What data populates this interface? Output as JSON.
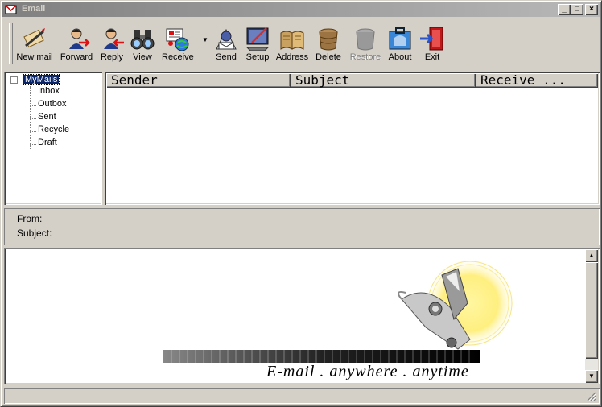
{
  "window": {
    "title": "Email"
  },
  "toolbar": {
    "buttons": [
      {
        "label": "New mail",
        "icon": "new-mail-icon",
        "enabled": true
      },
      {
        "label": "Forward",
        "icon": "forward-icon",
        "enabled": true
      },
      {
        "label": "Reply",
        "icon": "reply-icon",
        "enabled": true
      },
      {
        "label": "View",
        "icon": "binoculars-icon",
        "enabled": true
      },
      {
        "label": "Receive",
        "icon": "receive-icon",
        "enabled": true
      },
      {
        "label": "Send",
        "icon": "send-icon",
        "enabled": true
      },
      {
        "label": "Setup",
        "icon": "setup-icon",
        "enabled": true
      },
      {
        "label": "Address",
        "icon": "address-book-icon",
        "enabled": true
      },
      {
        "label": "Delete",
        "icon": "delete-icon",
        "enabled": true
      },
      {
        "label": "Restore",
        "icon": "restore-icon",
        "enabled": false
      },
      {
        "label": "About",
        "icon": "about-icon",
        "enabled": true
      },
      {
        "label": "Exit",
        "icon": "exit-icon",
        "enabled": true
      }
    ]
  },
  "tree": {
    "root": "MyMails",
    "folders": [
      "Inbox",
      "Outbox",
      "Sent",
      "Recycle",
      "Draft"
    ]
  },
  "list": {
    "columns": [
      "Sender",
      "Subject",
      "Receive ..."
    ]
  },
  "info": {
    "from_label": "From:",
    "subject_label": "Subject:"
  },
  "preview": {
    "slogan": "E-mail . anywhere . anytime"
  },
  "colors": {
    "title_inactive": "#808080",
    "selection": "#0a246a",
    "face": "#d4d0c8"
  }
}
